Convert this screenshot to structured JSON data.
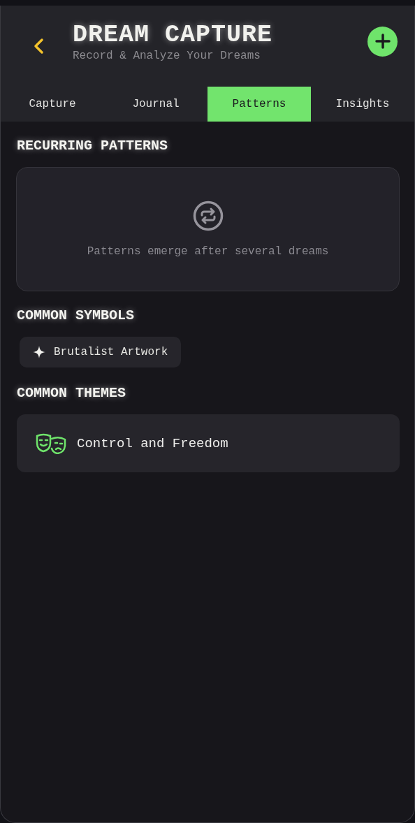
{
  "header": {
    "title": "DREAM CAPTURE",
    "subtitle": "Record & Analyze Your Dreams"
  },
  "tabs": [
    {
      "label": "Capture",
      "selected": false
    },
    {
      "label": "Journal",
      "selected": false
    },
    {
      "label": "Patterns",
      "selected": true
    },
    {
      "label": "Insights",
      "selected": false
    }
  ],
  "recurring_patterns": {
    "heading": "RECURRING PATTERNS",
    "empty_message": "Patterns emerge after several dreams"
  },
  "common_symbols": {
    "heading": "COMMON SYMBOLS",
    "items": [
      "Brutalist Artwork"
    ]
  },
  "common_themes": {
    "heading": "COMMON THEMES",
    "items": [
      "Control and Freedom"
    ]
  }
}
